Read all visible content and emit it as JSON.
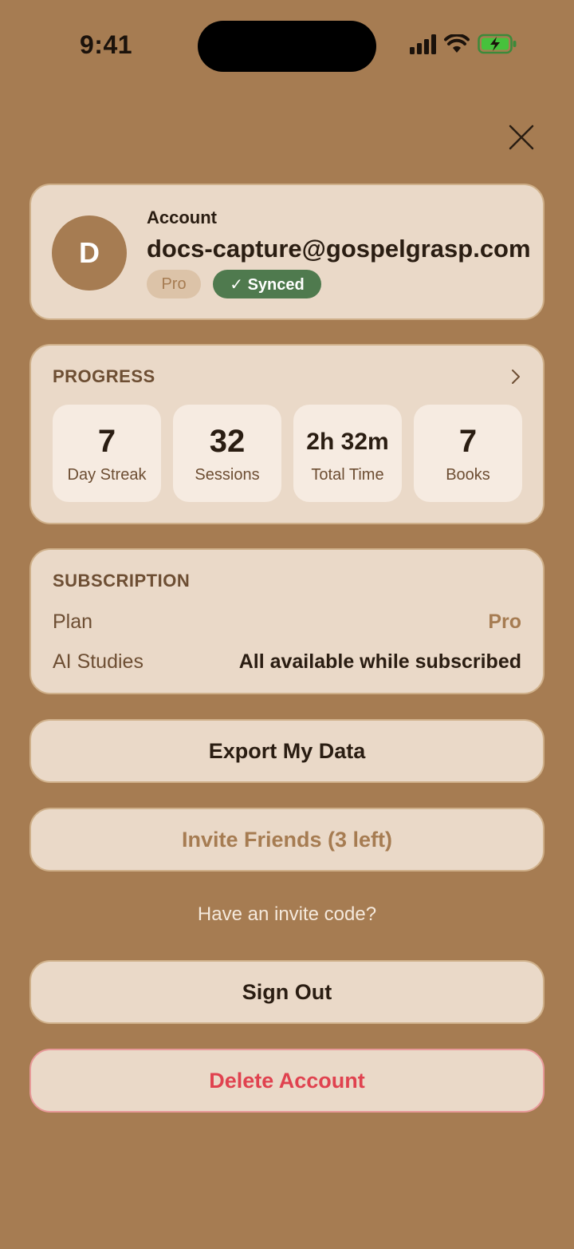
{
  "status_bar": {
    "time": "9:41"
  },
  "account": {
    "label": "Account",
    "avatar_initial": "D",
    "email": "docs-capture@gospelgrasp.com",
    "plan_badge": "Pro",
    "sync_badge": "✓ Synced"
  },
  "progress": {
    "title": "PROGRESS",
    "stats": [
      {
        "value": "7",
        "label": "Day Streak"
      },
      {
        "value": "32",
        "label": "Sessions"
      },
      {
        "value": "2h 32m",
        "label": "Total Time"
      },
      {
        "value": "7",
        "label": "Books"
      }
    ]
  },
  "subscription": {
    "title": "SUBSCRIPTION",
    "plan_label": "Plan",
    "plan_value": "Pro",
    "ai_label": "AI Studies",
    "ai_value": "All available while subscribed"
  },
  "actions": {
    "export": "Export My Data",
    "invite": "Invite Friends (3 left)",
    "invite_code_link": "Have an invite code?",
    "sign_out": "Sign Out",
    "delete": "Delete Account"
  },
  "colors": {
    "background": "#a67c52",
    "card": "#ead9c8",
    "synced": "#4f7a4e",
    "danger": "#e0424f"
  }
}
